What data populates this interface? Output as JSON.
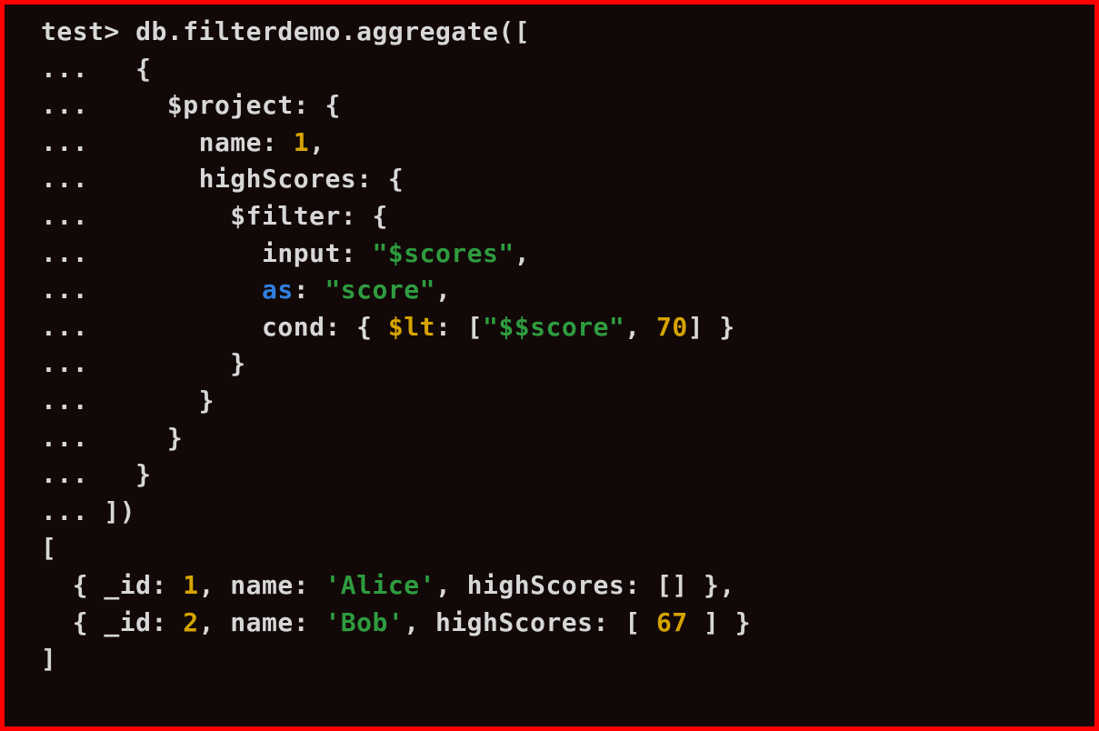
{
  "terminal": {
    "prompt": "test>",
    "cont": "...",
    "command": {
      "head": " db.filterdemo.aggregate([",
      "brace_open": "   {",
      "project_open": "     $project: {",
      "name_key": "       name: ",
      "name_val": "1",
      "name_comma": ",",
      "highscores_open": "       highScores: {",
      "filter_open": "         $filter: {",
      "input_key": "           input: ",
      "input_val": "\"$scores\"",
      "input_comma": ",",
      "as_indent": "           ",
      "as_key": "as",
      "as_colon": ": ",
      "as_val": "\"score\"",
      "as_comma": ",",
      "cond_key": "           cond: { ",
      "cond_op": "$lt",
      "cond_mid1": ": [",
      "cond_str": "\"$$score\"",
      "cond_mid2": ", ",
      "cond_num": "70",
      "cond_end": "] }",
      "filter_close": "         }",
      "highscores_close": "       }",
      "project_close": "     }",
      "brace_close": "   }",
      "array_close": " ])"
    },
    "output": {
      "open": "[",
      "r1_a": "  { _id: ",
      "r1_id": "1",
      "r1_b": ", name: ",
      "r1_name": "'Alice'",
      "r1_c": ", highScores: [] },",
      "r2_a": "  { _id: ",
      "r2_id": "2",
      "r2_b": ", name: ",
      "r2_name": "'Bob'",
      "r2_c": ", highScores: [ ",
      "r2_score": "67",
      "r2_d": " ] }",
      "close": "]"
    }
  }
}
